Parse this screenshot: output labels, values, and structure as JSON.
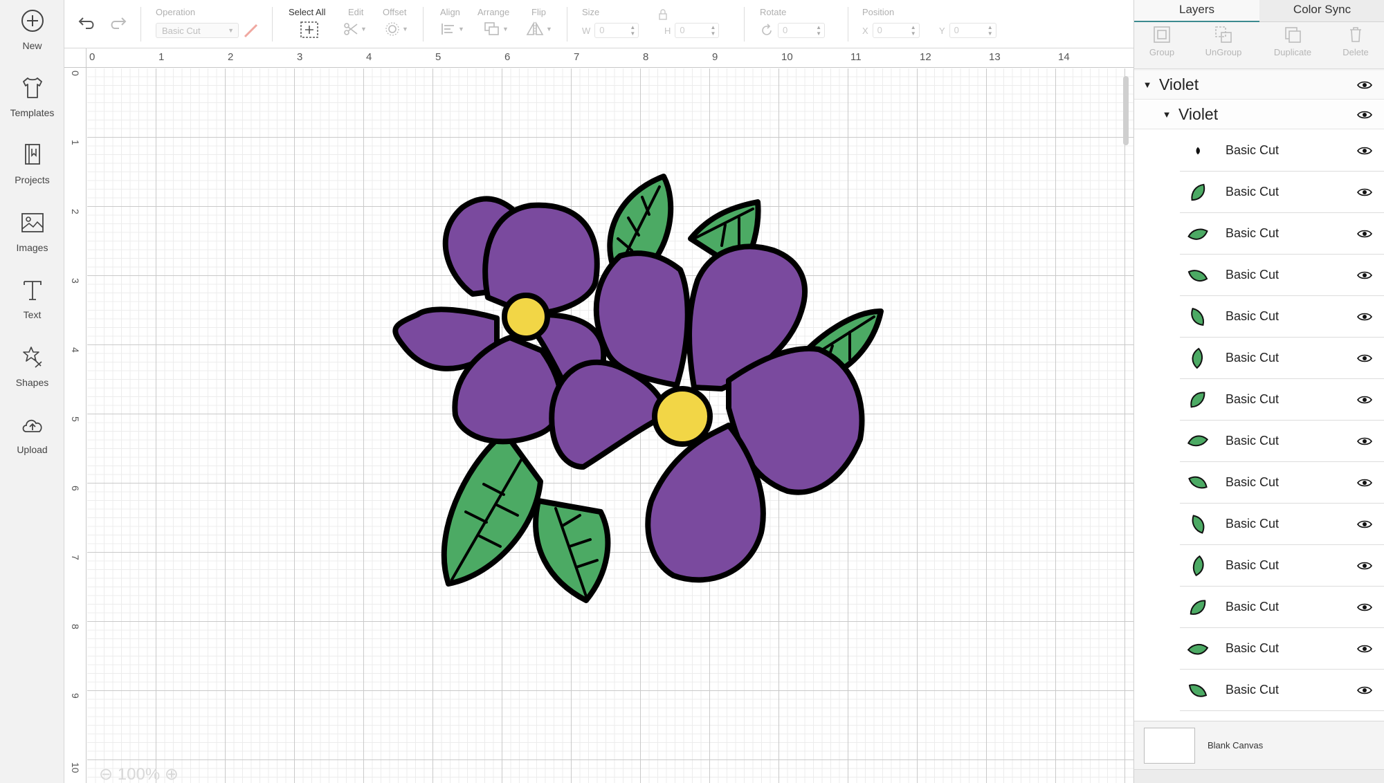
{
  "sidebar": {
    "items": [
      {
        "label": "New",
        "icon": "plus-circle-icon"
      },
      {
        "label": "Templates",
        "icon": "tshirt-icon"
      },
      {
        "label": "Projects",
        "icon": "book-icon"
      },
      {
        "label": "Images",
        "icon": "image-icon"
      },
      {
        "label": "Text",
        "icon": "text-icon"
      },
      {
        "label": "Shapes",
        "icon": "shapes-icon"
      },
      {
        "label": "Upload",
        "icon": "cloud-upload-icon"
      }
    ]
  },
  "toolbar": {
    "operation_label": "Operation",
    "operation_value": "Basic Cut",
    "select_all_label": "Select All",
    "edit_label": "Edit",
    "offset_label": "Offset",
    "align_label": "Align",
    "arrange_label": "Arrange",
    "flip_label": "Flip",
    "size_label": "Size",
    "size_w_label": "W",
    "size_w_value": "0",
    "size_h_label": "H",
    "size_h_value": "0",
    "rotate_label": "Rotate",
    "rotate_value": "0",
    "position_label": "Position",
    "position_x_label": "X",
    "position_x_value": "0",
    "position_y_label": "Y",
    "position_y_value": "0"
  },
  "canvas": {
    "ruler_top": [
      "0",
      "1",
      "2",
      "3",
      "4",
      "5",
      "6",
      "7",
      "8",
      "9",
      "10",
      "11",
      "12",
      "13",
      "14"
    ],
    "ruler_left": [
      "0",
      "1",
      "2",
      "3",
      "4",
      "5",
      "6",
      "7",
      "8",
      "9",
      "10"
    ],
    "zoom": "100%",
    "colors": {
      "petal": "#7a4a9e",
      "center": "#f2d646",
      "leaf": "#4caa64",
      "outline": "#000000"
    }
  },
  "panel": {
    "tabs": [
      "Layers",
      "Color Sync"
    ],
    "actions": [
      "Group",
      "UnGroup",
      "Duplicate",
      "Delete"
    ],
    "group_outer": "Violet",
    "group_inner": "Violet",
    "layers": [
      {
        "name": "Basic Cut",
        "thumb": "black-leaf-tiny"
      },
      {
        "name": "Basic Cut",
        "thumb": "green-leaf"
      },
      {
        "name": "Basic Cut",
        "thumb": "green-leaf"
      },
      {
        "name": "Basic Cut",
        "thumb": "green-leaf"
      },
      {
        "name": "Basic Cut",
        "thumb": "green-leaf"
      },
      {
        "name": "Basic Cut",
        "thumb": "green-leaf"
      },
      {
        "name": "Basic Cut",
        "thumb": "green-leaf"
      },
      {
        "name": "Basic Cut",
        "thumb": "green-leaf"
      },
      {
        "name": "Basic Cut",
        "thumb": "green-leaf"
      },
      {
        "name": "Basic Cut",
        "thumb": "green-leaf"
      },
      {
        "name": "Basic Cut",
        "thumb": "green-leaf"
      },
      {
        "name": "Basic Cut",
        "thumb": "green-leaf"
      },
      {
        "name": "Basic Cut",
        "thumb": "green-leaf"
      },
      {
        "name": "Basic Cut",
        "thumb": "green-leaf"
      }
    ],
    "blank_canvas_label": "Blank Canvas"
  }
}
